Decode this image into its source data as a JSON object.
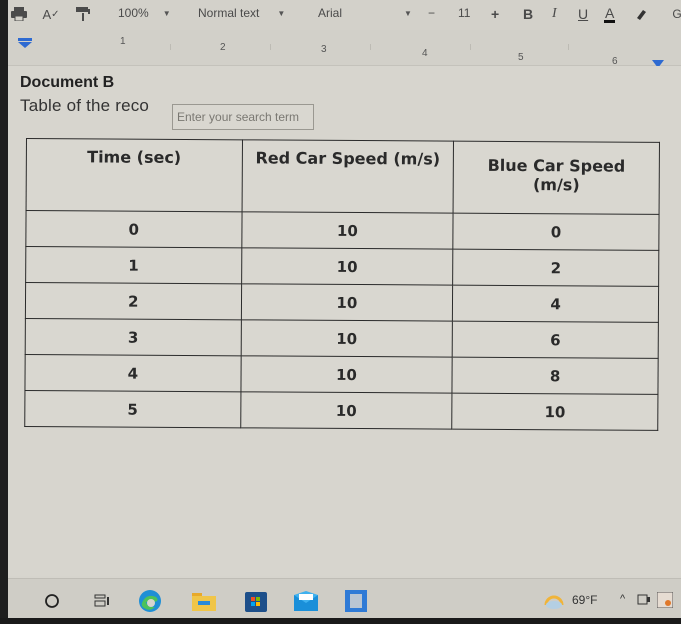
{
  "toolbar": {
    "icons": [
      "print-icon",
      "spellcheck-icon",
      "paint-format-icon"
    ],
    "zoom": "100%",
    "style": "Normal text",
    "font": "Arial",
    "font_size": "11",
    "decrease": "−",
    "increase": "+",
    "bold": "B",
    "italic": "I",
    "underline": "U",
    "text_color": "A",
    "highlight_icon": "highlight-pen-icon"
  },
  "ruler": {
    "numbers": [
      "1",
      "2",
      "3",
      "4",
      "5",
      "6"
    ]
  },
  "document": {
    "title": "Document B",
    "subtitle": "Table of the reco",
    "search_placeholder": "Enter your search term",
    "table": {
      "headers": [
        "Time (sec)",
        "Red Car Speed (m/s)",
        "Blue Car Speed (m/s)"
      ],
      "rows": [
        [
          "0",
          "10",
          "0"
        ],
        [
          "1",
          "10",
          "2"
        ],
        [
          "2",
          "10",
          "4"
        ],
        [
          "3",
          "10",
          "6"
        ],
        [
          "4",
          "10",
          "8"
        ],
        [
          "5",
          "10",
          "10"
        ]
      ]
    }
  },
  "taskbar": {
    "apps": [
      "search-circle-icon",
      "task-view-icon",
      "edge-icon",
      "file-explorer-icon",
      "microsoft-store-icon",
      "mail-icon",
      "photo-app-icon"
    ],
    "weather": "69°F",
    "colors": {
      "accent": "#2e6ad1",
      "edge_blue": "#1f8fd6",
      "edge_green": "#4cc25b",
      "folder": "#e8b93a"
    }
  }
}
